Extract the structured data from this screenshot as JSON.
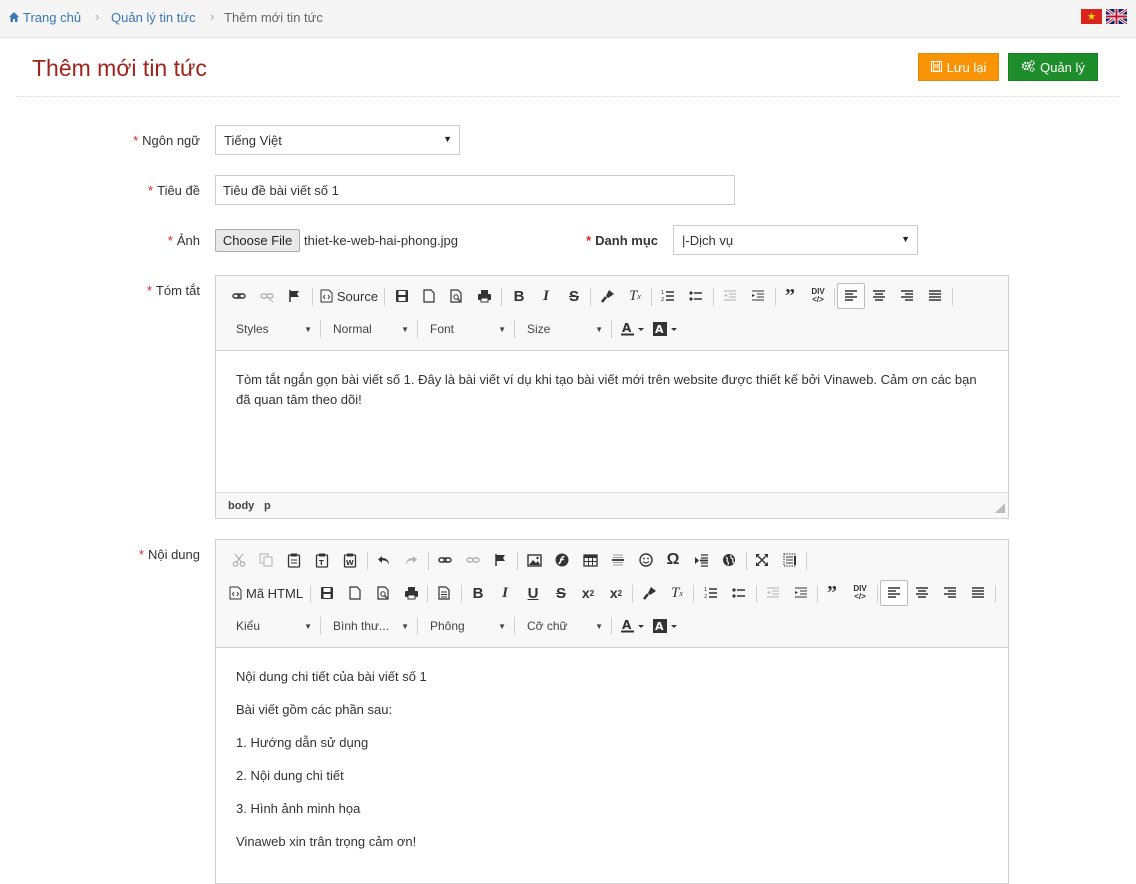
{
  "breadcrumb": {
    "home": "Trang chủ",
    "manage": "Quản lý tin tức",
    "current": "Thêm mới tin tức"
  },
  "header": {
    "title": "Thêm mới tin tức",
    "save_label": "Lưu lại",
    "manage_label": "Quản lý"
  },
  "form": {
    "language_label": "Ngôn ngữ",
    "language_value": "Tiếng Việt",
    "title_label": "Tiêu đề",
    "title_value": "Tiêu đề bài viết số 1",
    "image_label": "Ảnh",
    "file_button": "Choose File",
    "file_name": "thiet-ke-web-hai-phong.jpg",
    "category_label": "Danh mục",
    "category_value": "|-Dịch vụ",
    "summary_label": "Tóm tắt",
    "content_label": "Nội dung",
    "required_mark": "*"
  },
  "summary_editor": {
    "source_label": "Source",
    "combos": [
      "Styles",
      "Normal",
      "Font",
      "Size"
    ],
    "text": "Tòm tắt ngắn gọn bài viết số 1. Đây là bài viết ví dụ khi tạo bài viết mới trên website được thiết kế bởi Vinaweb. Cảm ơn các bạn đã quan tâm theo dõi!",
    "path_body": "body",
    "path_p": "p"
  },
  "content_editor": {
    "source_label": "Mã HTML",
    "combos": [
      "Kiểu",
      "Bình thư...",
      "Phông",
      "Cỡ chữ"
    ],
    "paragraphs": [
      "Nội dung chi tiết của bài viết số 1",
      "Bài viết gồm các phần sau:",
      "1. Hướng dẫn sử dụng",
      "2. Nội dung chi tiết",
      "3. Hình ảnh minh họa",
      "Vinaweb xin trân trọng cảm ơn!"
    ]
  },
  "colors": {
    "accent_title": "#a0231c",
    "save_button": "#f89406",
    "manage_button": "#1e8e2a",
    "link": "#3a77b5",
    "required": "#dd2222"
  }
}
